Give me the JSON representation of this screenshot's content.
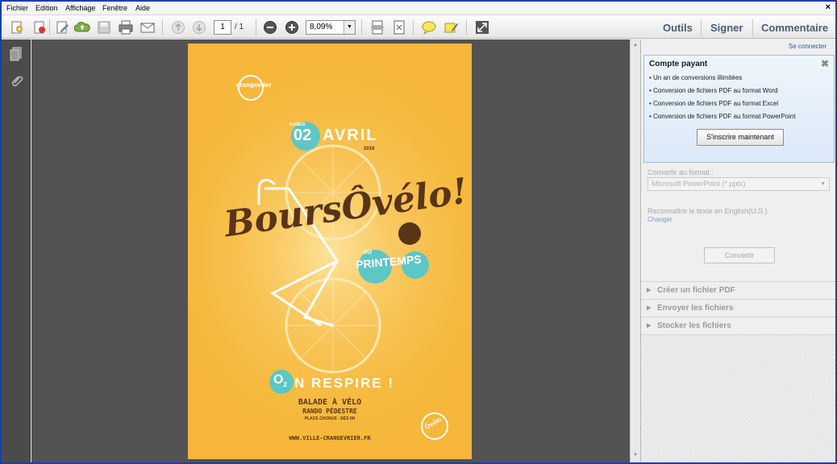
{
  "menu": {
    "items": [
      "Fichier",
      "Edition",
      "Affichage",
      "Fenêtre",
      "Aide"
    ],
    "close": "×"
  },
  "toolbar": {
    "page_current": "1",
    "page_total": "/ 1",
    "zoom": "8,09%",
    "dropdown_arrow": "▼",
    "tabs": [
      "Outils",
      "Signer",
      "Commentaire"
    ]
  },
  "panel": {
    "connect": "Se connecter",
    "promo": {
      "title": "Compte payant",
      "close": "✖",
      "items": [
        "• Un an de conversions illimitées",
        "• Conversion de fichiers PDF au format Word",
        "• Conversion de fichiers PDF au format Excel",
        "• Conversion de fichiers PDF au format PowerPoint"
      ],
      "button": "S'inscrire maintenant"
    },
    "convert_label": "Convertir au format :",
    "convert_format": "Microsoft PowerPoint (*.pptx)",
    "recognize": "Reconnaître le texte en English(U.S.)",
    "change": "Changer",
    "convert_button": "Convertir",
    "sections": [
      "Créer un fichier PDF",
      "Envoyer les fichiers",
      "Stocker les fichiers"
    ]
  },
  "poster": {
    "logo_text": "crangevrier",
    "day_label": "SAMEDI",
    "day": "02",
    "month": "AVRIL",
    "year": "2016",
    "title": "BoursÔvélo!",
    "subtitle_small": "DU",
    "subtitle": "PRINTEMPS",
    "o2": "O",
    "o2_sub": "2",
    "breath": "N RESPIRE !",
    "line1": "BALADE À VÉLO",
    "line2": "RANDO PÉDESTRE",
    "line3": "PLACE CHORUS · DÉS 9H",
    "url": "WWW.VILLE-CRANGEVRIER.FR",
    "badge": "Ôvélo",
    "colors": {
      "background": "#f6b73a",
      "teal": "#5cc7c4",
      "brown": "#5a3417"
    }
  }
}
